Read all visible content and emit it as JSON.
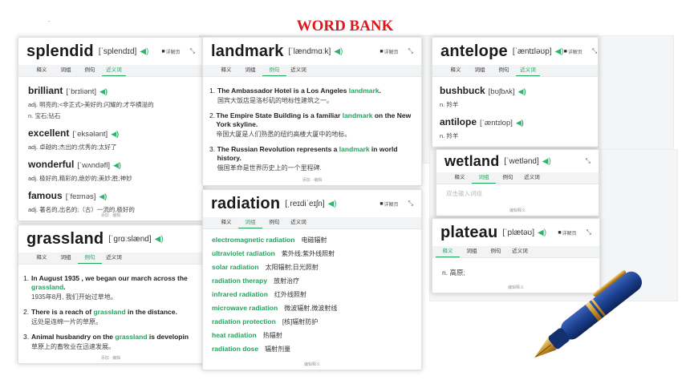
{
  "title": "WORD BANK",
  "dot": ".",
  "icons": {
    "speaker": "speaker-icon",
    "detail": "book-icon",
    "expand": "expand-icon"
  },
  "colors": {
    "title": "#e0161b",
    "highlight": "#24a35e"
  },
  "common": {
    "detail": "详解页",
    "expand": "⤡",
    "tabs": [
      "释义",
      "词组",
      "例句",
      "近义词"
    ],
    "foot_edit": "编辑释义",
    "foot_add": "添加",
    "foot_edit2": "编辑"
  },
  "splendid": {
    "word": "splendid",
    "phon": "[ˈsplendɪd]",
    "syn": [
      {
        "word": "brilliant",
        "ph": "[ˈbrɪliənt]",
        "defs": [
          "adj. 明亮的;<非正式>美好的;闪耀的;才华横溢的",
          "n. 宝石;钻石"
        ]
      },
      {
        "word": "excellent",
        "ph": "[ˈeksələnt]",
        "defs": [
          "adj. 卓越的;杰出的;优秀的;太好了"
        ]
      },
      {
        "word": "wonderful",
        "ph": "[ˈwʌndəfl]",
        "defs": [
          "adj. 极好的,精彩的,绝妙的;美妙;胜;神妙"
        ]
      },
      {
        "word": "famous",
        "ph": "[ˈfeɪməs]",
        "defs": [
          "adj. 著名的,出名的;（古）一流的,极好的"
        ]
      }
    ]
  },
  "landmark": {
    "word": "landmark",
    "phon": "[ˈlændmɑːk]",
    "ex": [
      {
        "n": "1.",
        "pre": "The Ambassador Hotel is a Los Angeles ",
        "hl": "landmark",
        "post": ".",
        "zh": "国宾大饭店是洛杉矶的地标性建筑之一。"
      },
      {
        "n": "2.",
        "pre": "The Empire State Building is a familiar ",
        "hl": "landmark",
        "post": " on the New York skyline.",
        "zh": "帝国大厦是人们熟悉的纽约高楼大厦中的地标。"
      },
      {
        "n": "3.",
        "pre": "The Russian Revolution represents a ",
        "hl": "landmark",
        "post": " in world history.",
        "zh": "俄国革命是世界历史上的一个里程碑."
      }
    ]
  },
  "antelope": {
    "word": "antelope",
    "phon": "[ˈæntɪləʊp]",
    "syn": [
      {
        "word": "bushbuck",
        "ph": "[bʊʃbʌk]",
        "defs": [
          "n. 羚羊"
        ]
      },
      {
        "word": "antilope",
        "ph": "[ˈæntɪlop]",
        "defs": [
          "n. 羚羊"
        ]
      }
    ]
  },
  "wetland": {
    "word": "wetland",
    "phon": "[ˈwetlənd]",
    "placeholder": "双击输入词组"
  },
  "plateau": {
    "word": "plateau",
    "phon": "[ˈplætəʊ]",
    "def": "n. 高原;"
  },
  "grassland": {
    "word": "grassland",
    "phon": "[ˈɡrɑːslænd]",
    "ex": [
      {
        "n": "1.",
        "pre": "In August 1935 , we began our march across the ",
        "hl": "grassland",
        "post": ".",
        "zh": "1935年8月, 我们开始过草地。"
      },
      {
        "n": "2.",
        "pre": "There is a reach of ",
        "hl": "grassland",
        "post": " in the distance.",
        "zh": "远处是连绵一片的草原。"
      },
      {
        "n": "3.",
        "pre": "Animal husbandry on the ",
        "hl": "grassland",
        "post": " is developin",
        "zh": "草原上的畜牧业在迅速发展。"
      }
    ]
  },
  "radiation": {
    "word": "radiation",
    "phon": "[ˌreɪdiˈeɪʃn]",
    "coll": [
      {
        "en": "electromagnetic radiation",
        "zh": "电磁辐射"
      },
      {
        "en": "ultraviolet radiation",
        "zh": "紫外线;紫外线照射"
      },
      {
        "en": "solar radiation",
        "zh": "太阳辐射;日光照射"
      },
      {
        "en": "radiation therapy",
        "zh": "放射治疗"
      },
      {
        "en": "infrared radiation",
        "zh": "红外线照射"
      },
      {
        "en": "microwave radiation",
        "zh": "微波辐射,微波射线"
      },
      {
        "en": "radiation protection",
        "zh": "[核]辐射防护"
      },
      {
        "en": "heat radiation",
        "zh": "热辐射"
      },
      {
        "en": "radiation dose",
        "zh": "辐射剂量"
      }
    ]
  }
}
